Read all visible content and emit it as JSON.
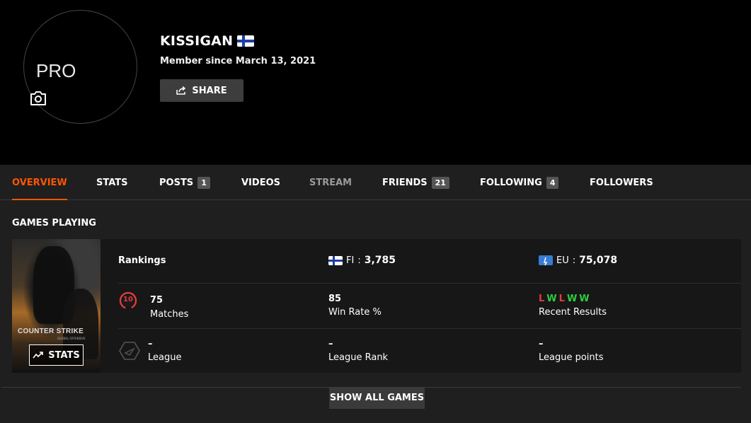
{
  "profile": {
    "avatar_text": "PRO",
    "username": "KISSIGAN",
    "member_since": "Member since March 13, 2021",
    "share_label": "SHARE"
  },
  "tabs": [
    {
      "label": "OVERVIEW",
      "badge": ""
    },
    {
      "label": "STATS",
      "badge": ""
    },
    {
      "label": "POSTS",
      "badge": "1"
    },
    {
      "label": "VIDEOS",
      "badge": ""
    },
    {
      "label": "STREAM",
      "badge": ""
    },
    {
      "label": "FRIENDS",
      "badge": "21"
    },
    {
      "label": "FOLLOWING",
      "badge": "4"
    },
    {
      "label": "FOLLOWERS",
      "badge": ""
    }
  ],
  "games": {
    "section_title": "GAMES PLAYING",
    "game": {
      "cover_logo": "COUNTER STRIKE",
      "cover_sub": "GLOBAL OFFENSIVE",
      "stats_label": "STATS",
      "rankings_label": "Rankings",
      "country_code": "FI",
      "country_rank": "3,785",
      "region_code": "EU",
      "region_rank": "75,078",
      "level": "10",
      "matches_value": "75",
      "matches_label": "Matches",
      "winrate_value": "85",
      "winrate_label": "Win Rate %",
      "recent_results": [
        "L",
        "W",
        "L",
        "W",
        "W"
      ],
      "recent_label": "Recent Results",
      "league_value": "–",
      "league_label": "League",
      "league_rank_value": "–",
      "league_rank_label": "League Rank",
      "league_points_value": "–",
      "league_points_label": "League points"
    },
    "show_all_label": "SHOW ALL GAMES"
  },
  "colors": {
    "accent": "#ff5500",
    "loss": "#e23b3b",
    "win": "#2ecc40",
    "flag_blue": "#1d3fa3"
  }
}
